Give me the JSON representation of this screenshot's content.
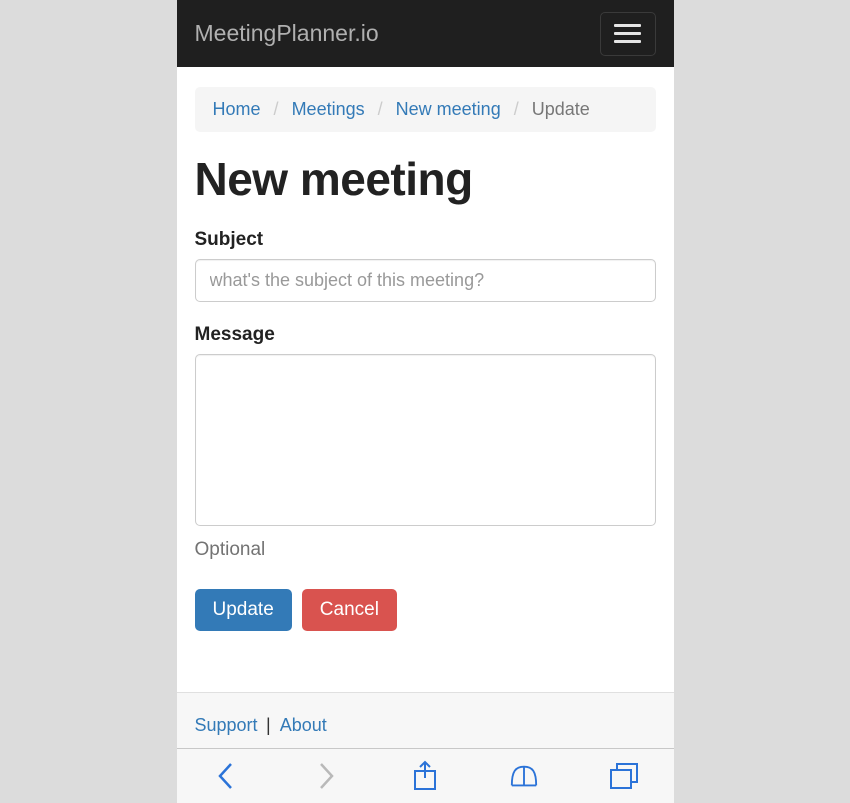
{
  "navbar": {
    "brand": "MeetingPlanner.io"
  },
  "breadcrumb": {
    "items": [
      {
        "label": "Home"
      },
      {
        "label": "Meetings"
      },
      {
        "label": "New meeting"
      }
    ],
    "current": "Update"
  },
  "page": {
    "title": "New meeting"
  },
  "form": {
    "subject": {
      "label": "Subject",
      "placeholder": "what's the subject of this meeting?",
      "value": ""
    },
    "message": {
      "label": "Message",
      "value": "",
      "help": "Optional"
    },
    "buttons": {
      "update": "Update",
      "cancel": "Cancel"
    }
  },
  "footer": {
    "support": "Support",
    "about": "About",
    "sep": " | "
  },
  "colors": {
    "link": "#337ab7",
    "danger": "#d9534f",
    "navbar": "#1f1f1f"
  }
}
